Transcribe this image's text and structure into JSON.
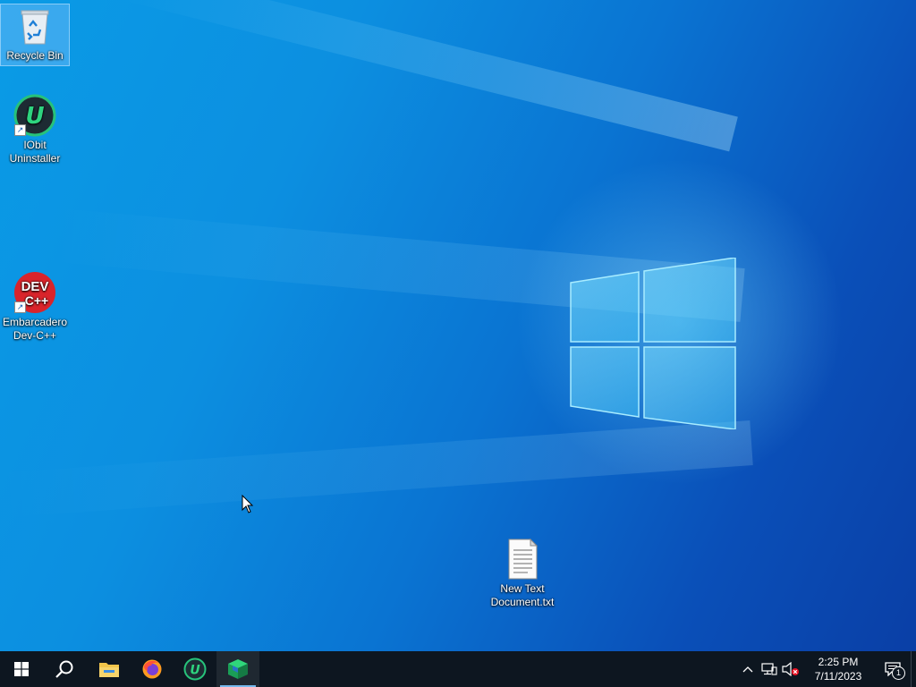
{
  "desktop": {
    "icons": [
      {
        "label": "Recycle Bin",
        "icon": "recycle-bin-icon"
      },
      {
        "label": "IObit\nUninstaller",
        "icon": "iobit-uninstaller-icon"
      },
      {
        "label": "Embarcadero\nDev-C++",
        "icon": "dev-cpp-icon",
        "icon_text_top": "DEV",
        "icon_text_bottom": "C++"
      },
      {
        "label": "New Text\nDocument.txt",
        "icon": "text-document-icon"
      }
    ]
  },
  "taskbar": {
    "pinned": [
      {
        "name": "start",
        "icon": "windows-start-icon"
      },
      {
        "name": "search",
        "icon": "search-icon"
      },
      {
        "name": "file-explorer",
        "icon": "folder-icon"
      },
      {
        "name": "firefox",
        "icon": "firefox-icon"
      },
      {
        "name": "iobit-uninstaller",
        "icon": "iobit-uninstaller-icon"
      },
      {
        "name": "app-cube",
        "icon": "green-cube-icon",
        "active": true
      }
    ],
    "tray": {
      "icons": [
        "chevron-up-icon",
        "network-icon",
        "volume-muted-icon"
      ],
      "time": "2:25 PM",
      "date": "7/11/2023",
      "notification_count": "1"
    }
  },
  "colors": {
    "taskbar": "#0d1620",
    "desktop_blue": "#0a8fe0",
    "accent": "#76b9ed"
  }
}
